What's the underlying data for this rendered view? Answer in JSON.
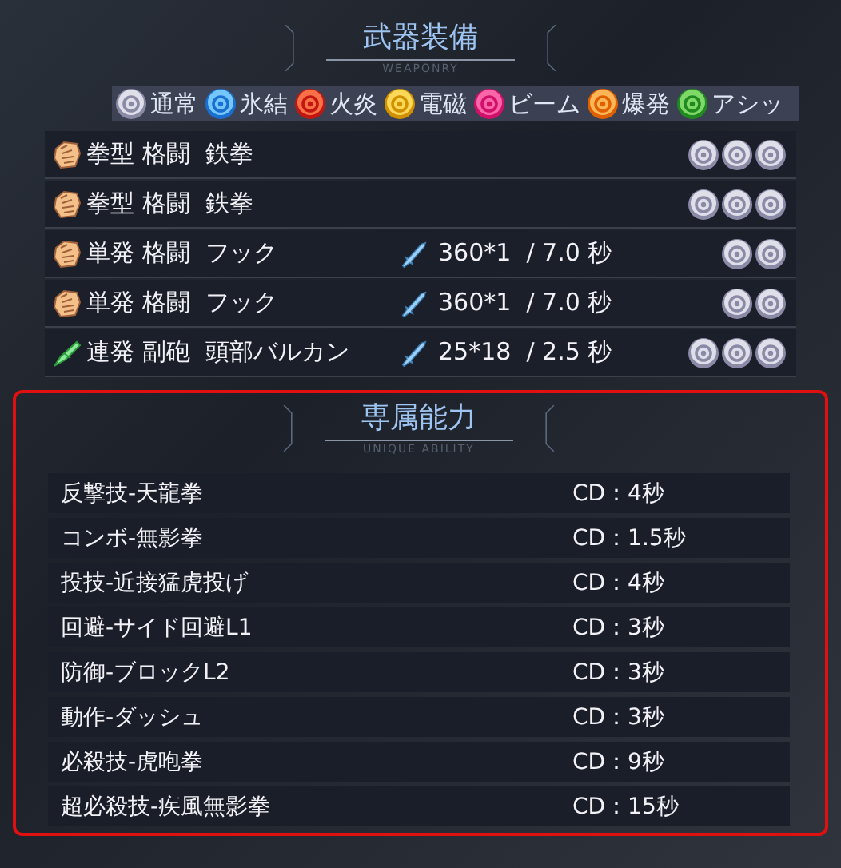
{
  "weaponry": {
    "title": "武器装備",
    "subtitle": "WEAPONRY",
    "elements": [
      {
        "kind": "normal",
        "label": "通常"
      },
      {
        "kind": "ice",
        "label": "氷結"
      },
      {
        "kind": "fire",
        "label": "火炎"
      },
      {
        "kind": "electric",
        "label": "電磁"
      },
      {
        "kind": "beam",
        "label": "ビーム"
      },
      {
        "kind": "explosive",
        "label": "爆発"
      },
      {
        "kind": "acid",
        "label": "アシッ"
      }
    ],
    "weapons": [
      {
        "kind": "fist",
        "name": "拳型 格闘  鉄拳",
        "slots": [
          {
            "kind": "normal"
          },
          {
            "kind": "normal"
          },
          {
            "kind": "normal"
          }
        ]
      },
      {
        "kind": "fist",
        "name": "拳型 格闘  鉄拳",
        "slots": [
          {
            "kind": "normal"
          },
          {
            "kind": "normal"
          },
          {
            "kind": "normal"
          }
        ]
      },
      {
        "kind": "fist",
        "name": "単発 格闘  フック",
        "damage": "360*1  / 7.0 秒",
        "slots": [
          {
            "kind": "normal"
          },
          {
            "kind": "normal"
          }
        ]
      },
      {
        "kind": "fist",
        "name": "単発 格闘  フック",
        "damage": "360*1  / 7.0 秒",
        "slots": [
          {
            "kind": "normal"
          },
          {
            "kind": "normal"
          }
        ]
      },
      {
        "kind": "gun",
        "name": "連発 副砲  頭部バルカン",
        "damage": "25*18  / 2.5 秒",
        "slots": [
          {
            "kind": "normal"
          },
          {
            "kind": "normal"
          },
          {
            "kind": "normal"
          }
        ]
      }
    ]
  },
  "unique_ability": {
    "title": "専属能力",
    "subtitle": "UNIQUE ABILITY",
    "abilities": [
      {
        "name": "反撃技-天龍拳",
        "cooldown": "CD：4秒"
      },
      {
        "name": "コンボ-無影拳",
        "cooldown": "CD：1.5秒"
      },
      {
        "name": "投技-近接猛虎投げ",
        "cooldown": "CD：4秒"
      },
      {
        "name": "回避-サイド回避L1",
        "cooldown": "CD：3秒"
      },
      {
        "name": "防御-ブロックL2",
        "cooldown": "CD：3秒"
      },
      {
        "name": "動作-ダッシュ",
        "cooldown": "CD：3秒"
      },
      {
        "name": "必殺技-虎咆拳",
        "cooldown": "CD：9秒"
      },
      {
        "name": "超必殺技-疾風無影拳",
        "cooldown": "CD：15秒"
      }
    ]
  }
}
